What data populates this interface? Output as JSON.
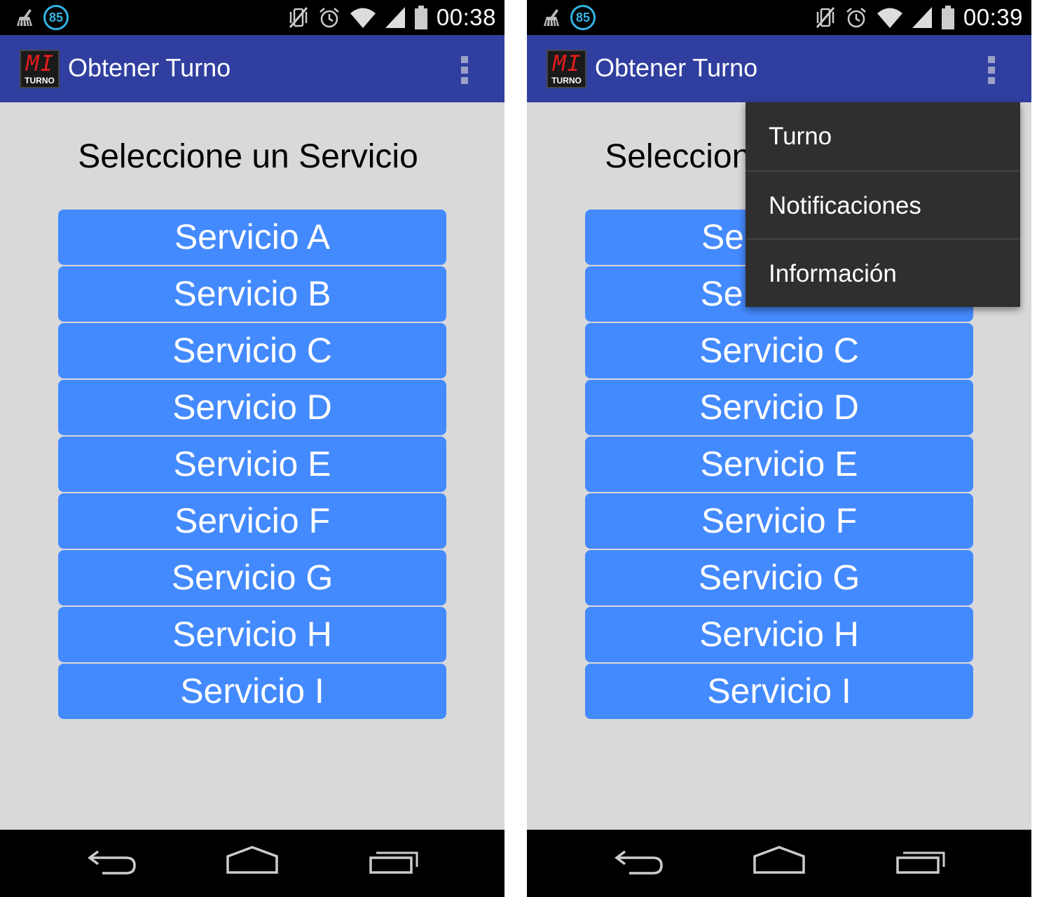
{
  "status_bar": {
    "badge": "85",
    "left_icons": [
      "cleaner-icon",
      "notification-85-icon"
    ],
    "right_icons": [
      "vibrate-off-icon",
      "alarm-icon",
      "wifi-icon",
      "signal-icon",
      "battery-icon"
    ]
  },
  "screens": [
    {
      "time": "00:38",
      "app_title": "Obtener Turno",
      "logo": {
        "mark": "MI",
        "label": "TURNO"
      },
      "heading": "Seleccione un Servicio",
      "services": [
        "Servicio A",
        "Servicio B",
        "Servicio C",
        "Servicio D",
        "Servicio E",
        "Servicio F",
        "Servicio G",
        "Servicio H",
        "Servicio I"
      ],
      "menu_open": false
    },
    {
      "time": "00:39",
      "app_title": "Obtener Turno",
      "logo": {
        "mark": "MI",
        "label": "TURNO"
      },
      "heading": "Seleccione un Servicio",
      "services": [
        "Servicio A",
        "Servicio B",
        "Servicio C",
        "Servicio D",
        "Servicio E",
        "Servicio F",
        "Servicio G",
        "Servicio H",
        "Servicio I"
      ],
      "menu_open": true,
      "menu": [
        "Turno",
        "Notificaciones",
        "Información"
      ]
    }
  ],
  "colors": {
    "app_bar": "#303f9f",
    "service_button": "#448aff",
    "background": "#d9d9d9",
    "menu_background": "#2f2f2f",
    "badge": "#33b5e5",
    "logo_mark": "#e81c1c"
  },
  "navigation_bar": [
    "back-icon",
    "home-icon",
    "recent-apps-icon"
  ]
}
